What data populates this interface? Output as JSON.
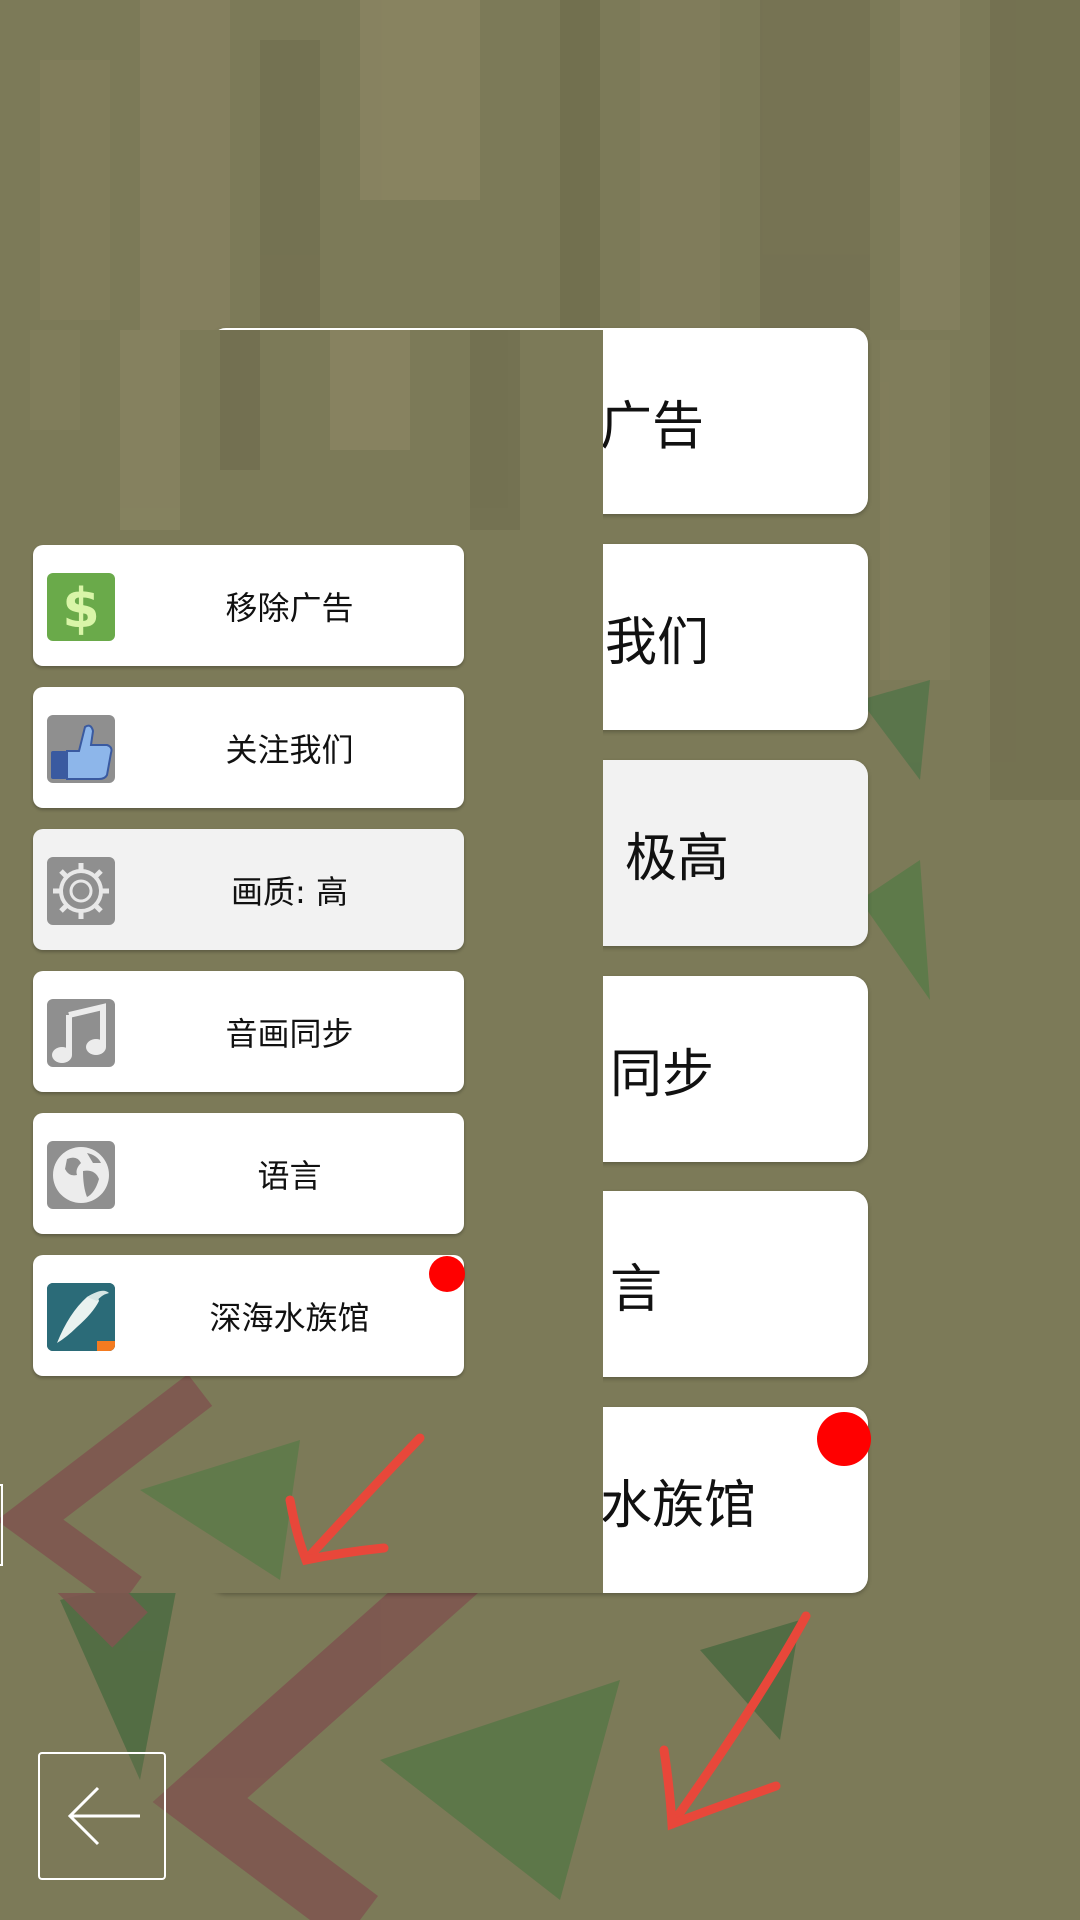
{
  "menu": {
    "items": [
      {
        "label": "移除广告",
        "icon": "dollar-icon",
        "badge": false
      },
      {
        "label": "关注我们",
        "icon": "thumbs-up-icon",
        "badge": false
      },
      {
        "label": "画质: 高",
        "icon": "gear-icon",
        "badge": false
      },
      {
        "label": "音画同步",
        "icon": "music-note-icon",
        "badge": false
      },
      {
        "label": "语言",
        "icon": "globe-icon",
        "badge": false
      },
      {
        "label": "深海水族馆",
        "icon": "whale-app-icon",
        "badge": true
      }
    ]
  },
  "background_menu": {
    "items": [
      {
        "label": "广告"
      },
      {
        "label": "我们"
      },
      {
        "label": "极高"
      },
      {
        "label": "同步"
      },
      {
        "label": "言"
      },
      {
        "label": "水族馆",
        "badge": true
      }
    ]
  },
  "navigation": {
    "back_icon": "arrow-left-icon"
  },
  "colors": {
    "background": "#7c7a58",
    "badge": "#ff0000",
    "annotation_arrow": "#e8473a",
    "dollar_icon_bg": "#6aaa4a",
    "thumb_icon_bg": "#8f8f8f"
  }
}
